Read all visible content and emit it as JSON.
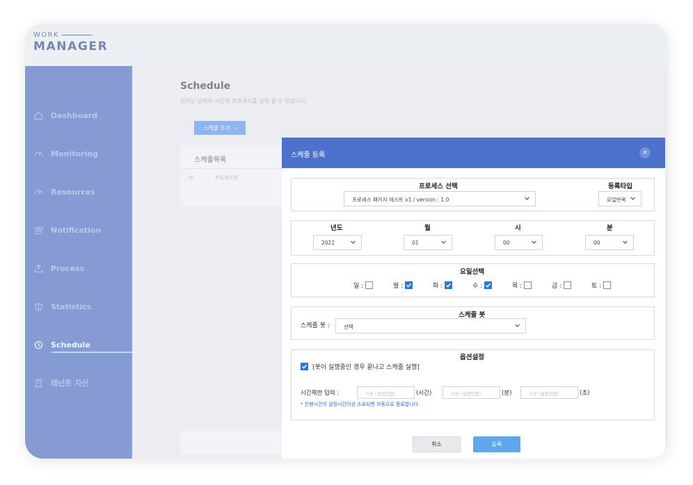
{
  "logo": {
    "line1": "WORK",
    "line2": "MANAGER"
  },
  "sidebar": {
    "items": [
      {
        "label": "Dashboard",
        "icon": "home-icon"
      },
      {
        "label": "Monitoring",
        "icon": "gauge-icon"
      },
      {
        "label": "Resources",
        "icon": "gauge-icon"
      },
      {
        "label": "Notification",
        "icon": "notification-icon"
      },
      {
        "label": "Process",
        "icon": "upload-icon"
      },
      {
        "label": "Statistics",
        "icon": "chart-icon"
      },
      {
        "label": "Schedule",
        "icon": "clock-icon",
        "active": true
      },
      {
        "label": "테넌트 자산",
        "icon": "building-icon"
      }
    ]
  },
  "page": {
    "title": "Schedule",
    "subtitle": "원하는 날짜와 시간에 프로세스를 실행 할 수 있습니다.",
    "add_button": "스케줄 추가",
    "list_title": "스케줄목록",
    "list_col1": "번··",
    "list_col2": "프로세스명"
  },
  "modal": {
    "title": "스케줄 등록",
    "close": "×",
    "process": {
      "label": "프로세스 선택",
      "value": "프로세스 패키지 테스트 v1 / version : 1.0",
      "type_label": "등록타입",
      "type_value": "요일반복"
    },
    "datetime": {
      "year_label": "년도",
      "year_value": "2022",
      "month_label": "월",
      "month_value": "01",
      "hour_label": "시",
      "hour_value": "00",
      "minute_label": "분",
      "minute_value": "00"
    },
    "weekday": {
      "label": "요일선택",
      "days": [
        {
          "label": "일 :",
          "checked": false
        },
        {
          "label": "월 :",
          "checked": true
        },
        {
          "label": "화 :",
          "checked": true
        },
        {
          "label": "수 :",
          "checked": true
        },
        {
          "label": "목 :",
          "checked": false
        },
        {
          "label": "금 :",
          "checked": false
        },
        {
          "label": "토 :",
          "checked": false
        }
      ]
    },
    "bot": {
      "section_label": "스케줄 봇",
      "field_label": "스케줄 봇 :",
      "value": "선택"
    },
    "options": {
      "label": "옵션설정",
      "checkbox_label": "[봇이 실행중인 경우 끝나고 스케줄 실행]",
      "checkbox_checked": true,
      "time_limit_label": "시간제한 입력 :",
      "placeholder": "기본 (설정안함)",
      "unit_hour": "(시간)",
      "unit_min": "(분)",
      "unit_sec": "(초)",
      "note": "* 진행시간이 설정시간이상 소요되면 자동으로 종료합니다."
    },
    "cancel_button": "취소",
    "submit_button": "등록"
  },
  "colors": {
    "sidebar": "#3c5fc2",
    "modal_header": "#4d72cc",
    "primary_button": "#5ea7ef",
    "checkbox": "#2a78d6"
  }
}
